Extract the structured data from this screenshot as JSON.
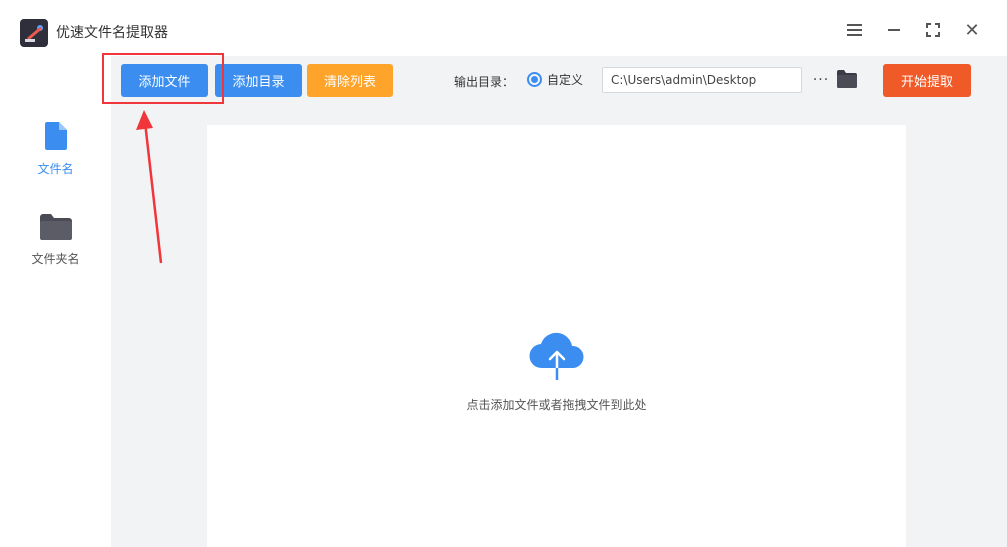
{
  "app": {
    "title": "优速文件名提取器"
  },
  "window_controls": {
    "menu_icon": "hamburger-menu-icon",
    "minimize_icon": "minimize-icon",
    "maximize_icon": "maximize-icon",
    "close_icon": "close-icon",
    "close_glyph": "✕"
  },
  "sidebar": {
    "items": [
      {
        "label": "文件名",
        "icon": "file-icon",
        "active": true
      },
      {
        "label": "文件夹名",
        "icon": "folder-icon",
        "active": false
      }
    ]
  },
  "toolbar": {
    "add_file_label": "添加文件",
    "add_dir_label": "添加目录",
    "clear_label": "清除列表",
    "output_label": "输出目录：",
    "radio_label": "自定义",
    "output_path": "C:\\Users\\admin\\Desktop",
    "browse_dots": "···",
    "start_label": "开始提取"
  },
  "dropzone": {
    "hint": "点击添加文件或者拖拽文件到此处",
    "icon": "cloud-upload-icon"
  },
  "colors": {
    "primary": "#3b8ef0",
    "warning": "#ffa42b",
    "danger": "#f05a28",
    "annotation": "#f0363a",
    "background": "#f2f3f5"
  }
}
